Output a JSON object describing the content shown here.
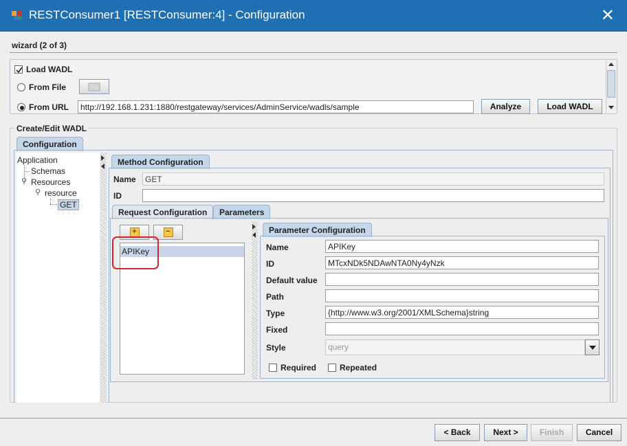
{
  "window": {
    "title": "RESTConsumer1 [RESTConsumer:4] - Configuration",
    "close_glyph": "✕",
    "app_icon": "palette-icon"
  },
  "wizard": {
    "step": "wizard (2 of 3)"
  },
  "load": {
    "load_wadl_label": "Load WADL",
    "load_wadl_checked": true,
    "from_file_label": "From File",
    "from_url_label": "From URL",
    "url_value": "http://192.168.1.231:1880/restgateway/services/AdminService/wadls/sample",
    "analyze_label": "Analyze",
    "load_wadl_button": "Load WADL"
  },
  "create_edit": {
    "title": "Create/Edit WADL",
    "tab_configuration": "Configuration"
  },
  "tree": {
    "application": "Application",
    "schemas": "Schemas",
    "resources": "Resources",
    "resource": "resource",
    "get": "GET"
  },
  "method": {
    "tab_label": "Method Configuration",
    "name_label": "Name",
    "name_value": "GET",
    "id_label": "ID",
    "id_value": "",
    "tab_request": "Request Configuration",
    "tab_parameters": "Parameters"
  },
  "params": {
    "add_glyph": "+",
    "remove_glyph": "−",
    "items": [
      "APIKey"
    ]
  },
  "param_config": {
    "tab_label": "Parameter Configuration",
    "name_label": "Name",
    "name_value": "APIKey",
    "id_label": "ID",
    "id_value": "MTcxNDk5NDAwNTA0Ny4yNzk",
    "default_label": "Default value",
    "default_value": "",
    "path_label": "Path",
    "path_value": "",
    "type_label": "Type",
    "type_value": "{http://www.w3.org/2001/XMLSchema}string",
    "fixed_label": "Fixed",
    "fixed_value": "",
    "style_label": "Style",
    "style_value": "query",
    "required_label": "Required",
    "repeated_label": "Repeated"
  },
  "footer": {
    "back": "< Back",
    "next": "Next >",
    "finish": "Finish",
    "cancel": "Cancel"
  },
  "colors": {
    "titlebar": "#1f6fb3",
    "highlight": "#d9232a",
    "selection": "#c6d6e8"
  }
}
